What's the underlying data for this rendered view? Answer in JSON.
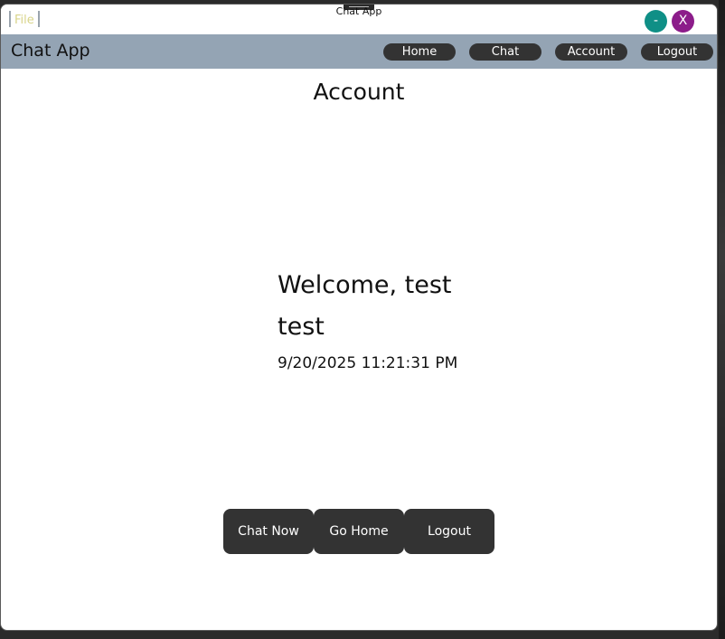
{
  "window": {
    "title": "Chat App",
    "file_menu_label": "File",
    "minimize_label": "-",
    "close_label": "X"
  },
  "navbar": {
    "app_title": "Chat App",
    "items": [
      {
        "label": "Home"
      },
      {
        "label": "Chat"
      },
      {
        "label": "Account"
      },
      {
        "label": "Logout"
      }
    ]
  },
  "page": {
    "title": "Account",
    "welcome": "Welcome, test",
    "username": "test",
    "datetime": "9/20/2025 11:21:31 PM"
  },
  "actions": {
    "chat_now": "Chat Now",
    "go_home": "Go Home",
    "logout": "Logout"
  },
  "colors": {
    "navbar_bg": "#94a4b4",
    "button_bg": "#333333",
    "minimize_bg": "#0f8f86",
    "close_bg": "#8c1c8a"
  }
}
